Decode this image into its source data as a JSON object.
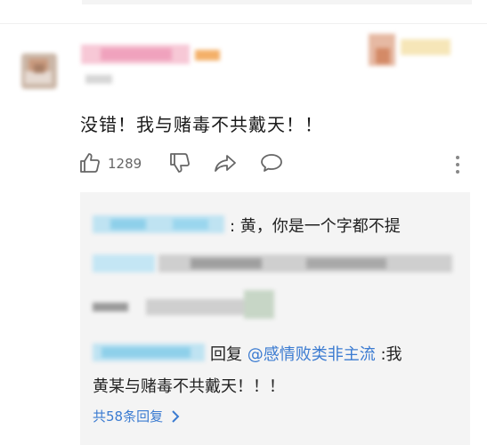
{
  "comment": {
    "text": "没错！我与赌毒不共戴天！！",
    "like_count": "1289"
  },
  "actions": {
    "like_icon": "thumbs-up-icon",
    "dislike_icon": "thumbs-down-icon",
    "share_icon": "share-icon",
    "reply_icon": "comment-bubble-icon",
    "more_icon": "more-vertical-icon"
  },
  "replies": {
    "first_text": ": 黄，你是一个字都不提",
    "second_reply_word": "回复",
    "second_mention": "@感情败类非主流",
    "second_text_a": ":我",
    "second_text_b": "黄某与赌毒不共戴天！！！",
    "view_more": "共58条回复"
  },
  "colors": {
    "link": "#3b7bd1",
    "card_bg": "#f4f4f4",
    "icon": "#666666"
  }
}
